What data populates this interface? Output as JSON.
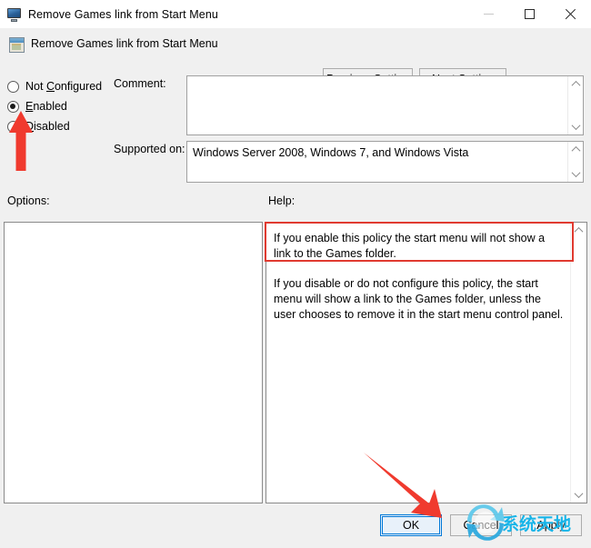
{
  "window": {
    "title": "Remove Games link from Start Menu",
    "title_icon": "monitor-icon",
    "minimize_label": "minimize-icon",
    "maximize_label": "maximize-icon",
    "close_label": "close-icon"
  },
  "header": {
    "icon": "policy-setting-icon",
    "title": "Remove Games link from Start Menu",
    "previous_setting": "Previous Setting",
    "previous_setting_accel": "P",
    "next_setting": "Next Setting",
    "next_setting_accel": "N"
  },
  "state": {
    "options": [
      {
        "label": "Not Configured",
        "accel": "C",
        "selected": false
      },
      {
        "label": "Enabled",
        "accel": "E",
        "selected": true
      },
      {
        "label": "Disabled",
        "accel": "D",
        "selected": false
      }
    ]
  },
  "fields": {
    "comment_label": "Comment:",
    "comment_value": "",
    "supported_label": "Supported on:",
    "supported_value": "Windows Server 2008, Windows 7, and Windows Vista"
  },
  "panes": {
    "options_label": "Options:",
    "options_content": "",
    "help_label": "Help:",
    "help_paragraphs": [
      "If you enable this policy the start menu will not show a link to the Games folder.",
      "If you disable or do not configure this policy, the start menu will show a link to the Games folder, unless the user chooses to remove it in the start menu control panel."
    ]
  },
  "buttons": {
    "ok": "OK",
    "cancel": "Cancel",
    "apply": "Apply"
  },
  "annotations": {
    "highlight_color": "#e03a30",
    "arrow_color": "#f03a2e",
    "focus_color": "#0078d7",
    "arrow_to_enabled": "red-arrow-pointing-to-enabled-radio",
    "arrow_to_ok": "red-arrow-pointing-to-ok-button",
    "highlight_box": "red-rectangle-around-first-help-paragraph"
  },
  "watermark": {
    "text": "系统天地",
    "color": "#17b4e8",
    "logo": "refresh-circular-arrows-logo"
  }
}
